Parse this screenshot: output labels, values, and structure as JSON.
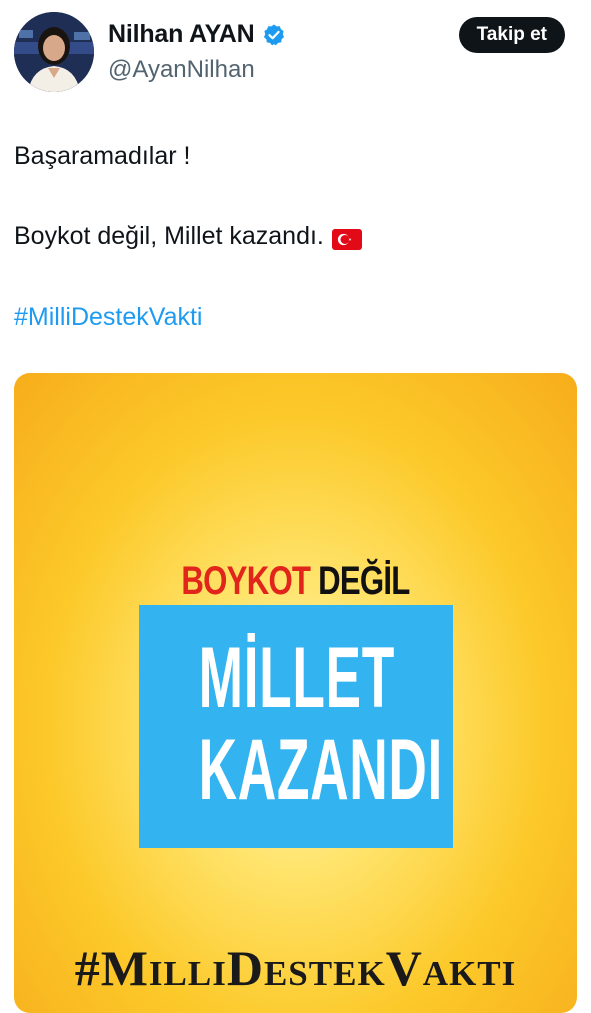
{
  "author": {
    "display_name": "Nilhan AYAN",
    "handle": "@AyanNilhan",
    "verified": true
  },
  "follow_button_label": "Takip et",
  "tweet": {
    "line1": "Başaramadılar !",
    "line2": "Boykot değil, Millet kazandı.",
    "hashtag": "#MilliDestekVakti"
  },
  "media": {
    "boykot_red": "BOYKOT",
    "boykot_dark": "DEĞİL",
    "box_line1": "MİLLET",
    "box_line2": "KAZANDI",
    "hashtag_banner": "#MilliDestekVakti"
  },
  "colors": {
    "verified_blue": "#1d9bf0",
    "hashtag_blue": "#1d9bf0",
    "button_bg": "#0f1419",
    "banner_blue": "#33b3ef",
    "banner_red": "#e1251b",
    "background_yellow": "#fcc92a"
  },
  "icons": {
    "verified": "verified-badge-icon",
    "flag": "turkey-flag-icon"
  }
}
